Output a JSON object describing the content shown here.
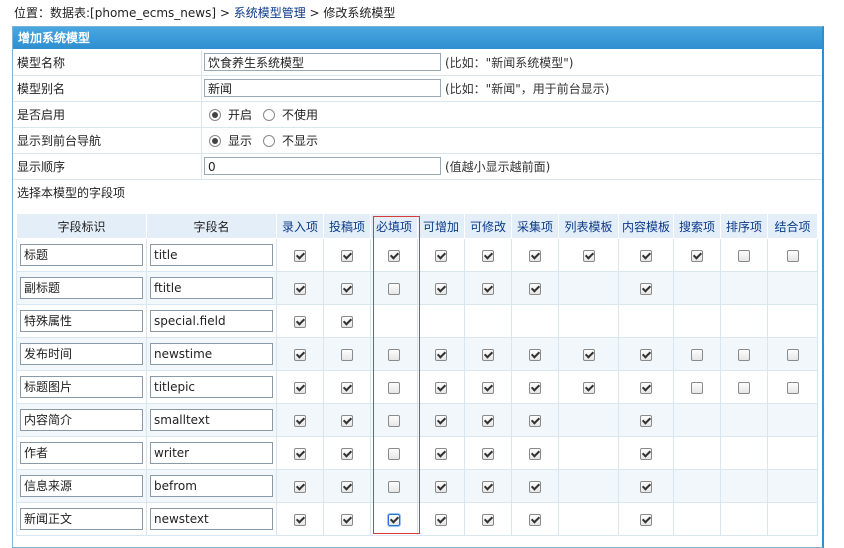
{
  "breadcrumb": {
    "prefix": "位置：数据表:[phome_ecms_news] > ",
    "link": "系统模型管理",
    "suffix": " > 修改系统模型"
  },
  "panel": {
    "title": "增加系统模型"
  },
  "form": {
    "model_name_label": "模型名称",
    "model_name_value": "饮食养生系统模型",
    "model_name_hint": "(比如：\"新闻系统模型\")",
    "alias_label": "模型别名",
    "alias_value": "新闻",
    "alias_hint": "(比如：\"新闻\"，用于前台显示)",
    "enable_label": "是否启用",
    "enable_on": "开启",
    "enable_off": "不使用",
    "enable_selected": "开启",
    "nav_label": "显示到前台导航",
    "nav_on": "显示",
    "nav_off": "不显示",
    "nav_selected": "显示",
    "order_label": "显示顺序",
    "order_value": "0",
    "order_hint": "(值越小显示越前面)",
    "fields_label": "选择本模型的字段项"
  },
  "table": {
    "columns": [
      "字段标识",
      "字段名",
      "录入项",
      "投稿项",
      "必填项",
      "可增加",
      "可修改",
      "采集项",
      "列表模板",
      "内容模板",
      "搜索项",
      "排序项",
      "结合项"
    ],
    "rows": [
      {
        "label": "标题",
        "field": "title",
        "checks": [
          1,
          1,
          1,
          1,
          1,
          1,
          1,
          1,
          1,
          0,
          0
        ]
      },
      {
        "label": "副标题",
        "field": "ftitle",
        "checks": [
          1,
          1,
          0,
          1,
          1,
          1,
          null,
          1,
          null,
          null,
          null
        ]
      },
      {
        "label": "特殊属性",
        "field": "special.field",
        "checks": [
          1,
          1,
          null,
          null,
          null,
          null,
          null,
          null,
          null,
          null,
          null
        ]
      },
      {
        "label": "发布时间",
        "field": "newstime",
        "checks": [
          1,
          0,
          0,
          1,
          1,
          1,
          1,
          1,
          0,
          0,
          0
        ]
      },
      {
        "label": "标题图片",
        "field": "titlepic",
        "checks": [
          1,
          1,
          0,
          1,
          1,
          1,
          1,
          1,
          0,
          0,
          0
        ]
      },
      {
        "label": "内容简介",
        "field": "smalltext",
        "checks": [
          1,
          1,
          0,
          1,
          1,
          1,
          null,
          1,
          null,
          null,
          null
        ]
      },
      {
        "label": "作者",
        "field": "writer",
        "checks": [
          1,
          1,
          0,
          1,
          1,
          1,
          null,
          1,
          null,
          null,
          null
        ]
      },
      {
        "label": "信息来源",
        "field": "befrom",
        "checks": [
          1,
          1,
          0,
          1,
          1,
          1,
          null,
          1,
          null,
          null,
          null
        ]
      },
      {
        "label": "新闻正文",
        "field": "newstext",
        "checks": [
          1,
          1,
          1,
          1,
          1,
          1,
          null,
          1,
          null,
          null,
          null
        ]
      }
    ]
  }
}
